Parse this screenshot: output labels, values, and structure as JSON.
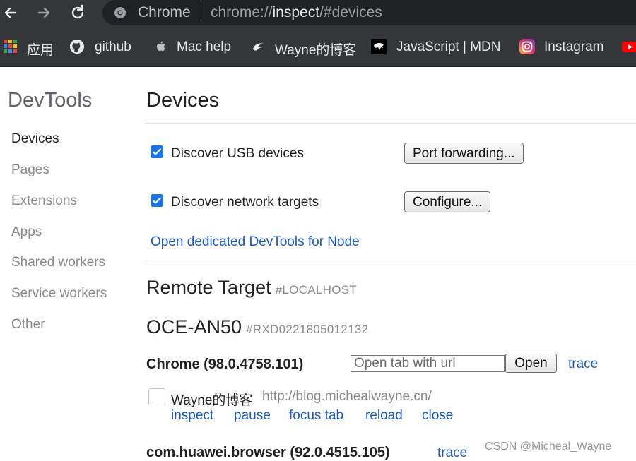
{
  "browser": {
    "site_name": "Chrome",
    "url_scheme": "chrome://",
    "url_host": "inspect",
    "url_path": "/#devices"
  },
  "bookmarks": [
    {
      "label": "应用",
      "icon": "apps-grid-icon"
    },
    {
      "label": "github",
      "icon": "github-icon"
    },
    {
      "label": "Mac help",
      "icon": "apple-icon"
    },
    {
      "label": "Wayne的博客",
      "icon": "blog-icon"
    },
    {
      "label": "JavaScript | MDN",
      "icon": "mdn-icon"
    },
    {
      "label": "Instagram",
      "icon": "instagram-icon"
    }
  ],
  "sidebar": {
    "title": "DevTools",
    "items": [
      {
        "label": "Devices",
        "active": true
      },
      {
        "label": "Pages"
      },
      {
        "label": "Extensions"
      },
      {
        "label": "Apps"
      },
      {
        "label": "Shared workers"
      },
      {
        "label": "Service workers"
      },
      {
        "label": "Other"
      }
    ]
  },
  "main": {
    "title": "Devices",
    "usb": {
      "label": "Discover USB devices",
      "checked": true,
      "button": "Port forwarding..."
    },
    "network": {
      "label": "Discover network targets",
      "checked": true,
      "button": "Configure..."
    },
    "node_link": "Open dedicated DevTools for Node",
    "remote_title": "Remote Target",
    "remote_sub": "#LOCALHOST",
    "device_name": "OCE-AN50",
    "device_serial": "#RXD0221805012132",
    "browser1": {
      "name": "Chrome (98.0.4758.101)",
      "url_placeholder": "Open tab with url",
      "open_label": "Open",
      "trace_label": "trace"
    },
    "page": {
      "title": "Wayne的博客",
      "url": "http://blog.michealwayne.cn/",
      "actions": [
        "inspect",
        "pause",
        "focus tab",
        "reload",
        "close"
      ]
    },
    "browser2": {
      "name": "com.huawei.browser (92.0.4515.105)",
      "trace_label": "trace"
    }
  },
  "watermark": "CSDN @Micheal_Wayne",
  "colors": {
    "accent": "#1a73e8",
    "link": "#1a58c9",
    "toolbar": "#35363a"
  }
}
